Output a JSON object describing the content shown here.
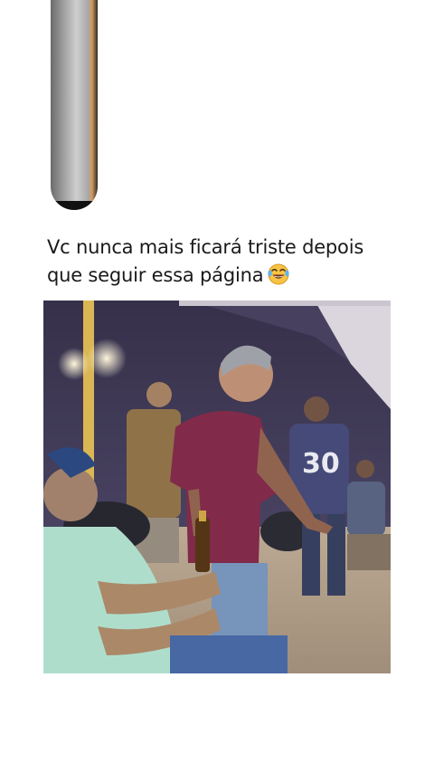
{
  "post": {
    "caption_line1": "Vc nunca mais ficará triste depois",
    "caption_line2": "que seguir essa página",
    "caption_emoji": "tears-of-joy-emoji"
  },
  "video": {
    "jersey_number": "30"
  },
  "colors": {
    "background": "#ffffff",
    "caption_text": "#1a1a1a",
    "shirt_maroon": "#7a1d3f"
  }
}
